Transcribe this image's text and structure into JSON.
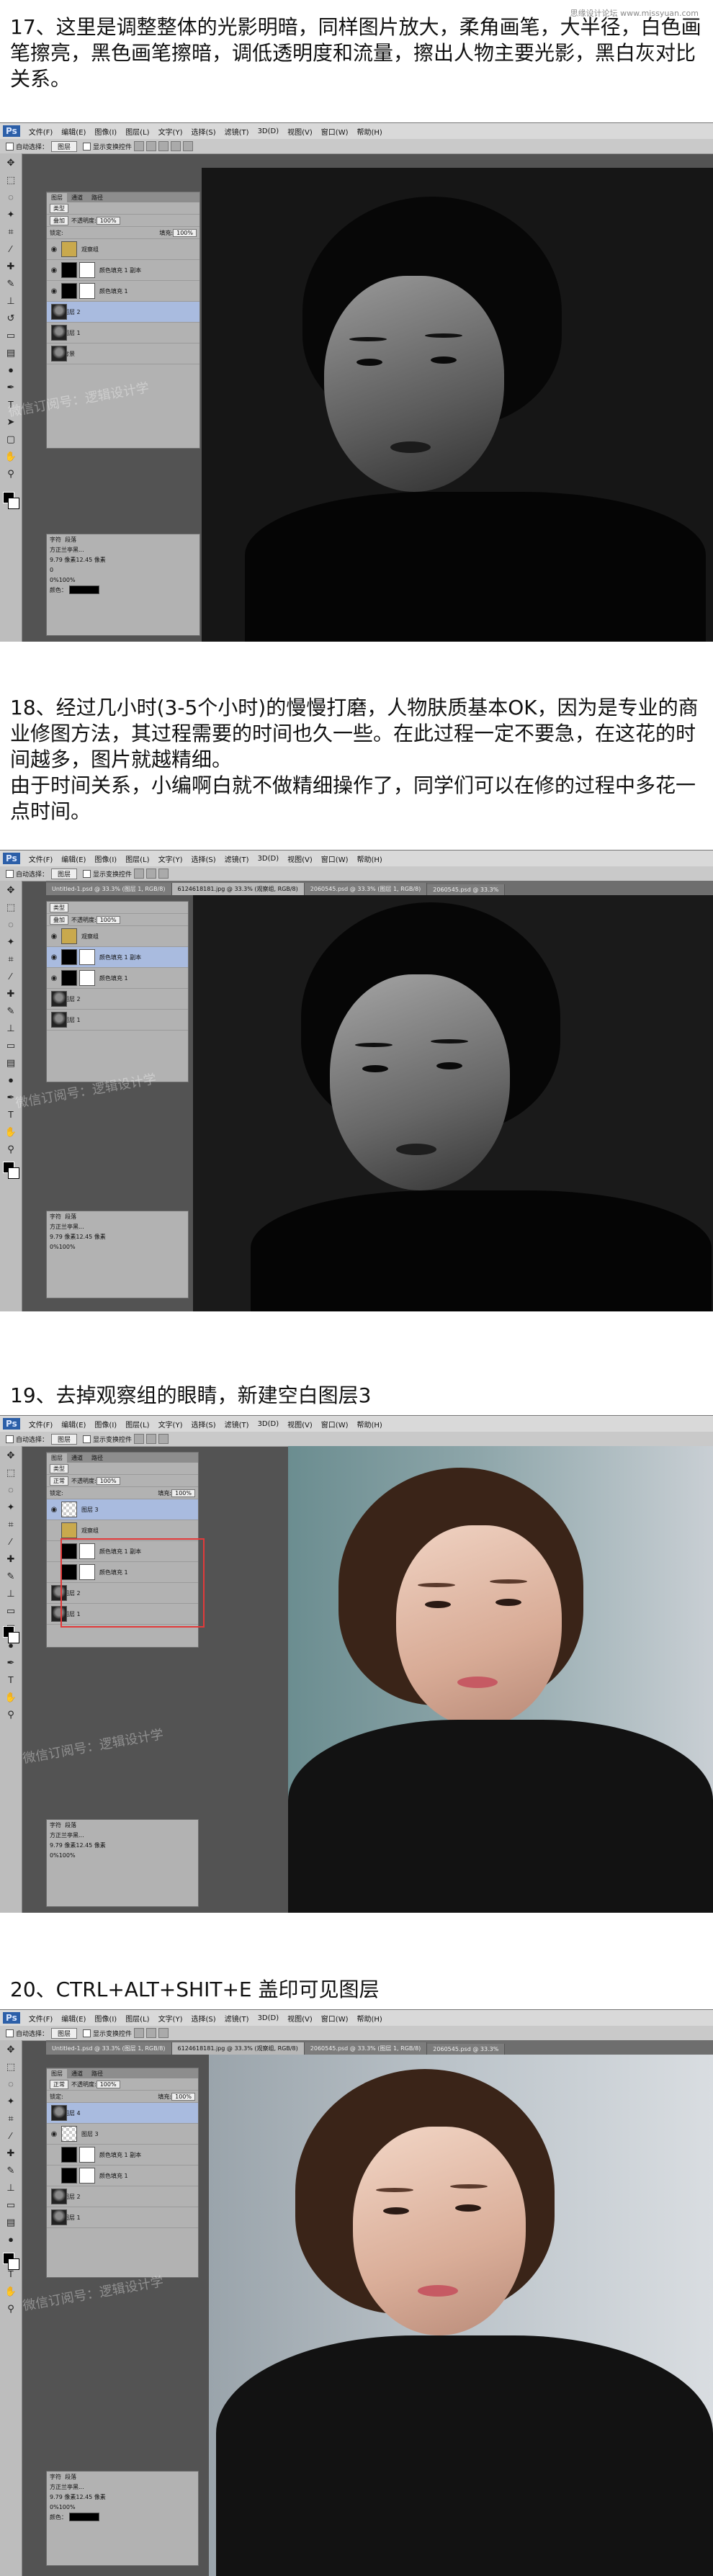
{
  "site_watermark": "思缘设计论坛 www.missyuan.com",
  "steps": [
    {
      "lines": [
        "17、这里是调整整体的光影明暗，同样图片放大，柔角画笔，大半径，白色画笔擦亮，黑色画笔擦暗，调低透明度和流量，擦出人物主要光影，黑白灰对比关系。"
      ]
    },
    {
      "lines": [
        "18、经过几小时(3-5个小时)的慢慢打磨，人物肤质基本OK，因为是专业的商业修图方法，其过程需要的时间也久一些。在此过程一定不要急，在这花的时间越多，图片就越精细。",
        "由于时间关系，小编啊白就不做精细操作了，同学们可以在修的过程中多花一点时间。"
      ]
    },
    {
      "lines": [
        "19、去掉观察组的眼睛，新建空白图层3"
      ]
    },
    {
      "lines": [
        "20、CTRL+ALT+SHIT+E 盖印可见图层"
      ]
    }
  ],
  "ps": {
    "logo": "Ps",
    "menu": [
      "文件(F)",
      "编辑(E)",
      "图像(I)",
      "图层(L)",
      "文字(Y)",
      "选择(S)",
      "滤镜(T)",
      "3D(D)",
      "视图(V)",
      "窗口(W)",
      "帮助(H)"
    ],
    "options": {
      "auto_select": "自动选择：",
      "group": "图层",
      "transform": "显示变换控件"
    },
    "tabs": [
      "Untitled-1.psd @ 33.3% (图层 1, RGB/8)",
      "6124618181.jpg @ 33.3% (观察组, RGB/8)",
      "2060545.psd @ 33.3% (图层 1, RGB/8)",
      "2060545.psd @ 33.3%"
    ],
    "watermark": "微信订阅号：逻辑设计学",
    "layers_panel": {
      "tabs": [
        "图层",
        "通道",
        "路径"
      ],
      "kind": "类型",
      "blend_normal": "正常",
      "blend_overlay": "叠加",
      "opacity_label": "不透明度:",
      "opacity_value": "100%",
      "lock_label": "锁定:",
      "fill_label": "填充:",
      "fill_value": "100%",
      "group_name": "观察组",
      "layer_names": {
        "hue_copy": "颜色填充 1 副本",
        "hue": "颜色填充 1",
        "layer1": "图层 1",
        "layer2": "图层 2",
        "layer3": "图层 3",
        "layer4": "图层 4",
        "bg": "背景"
      }
    },
    "char_panel": {
      "tabs": [
        "字符",
        "段落"
      ],
      "font": "方正兰亭黑...",
      "size": "9.79 像素",
      "leading": "12.45 像素",
      "tracking": "0",
      "scale_v": "0%",
      "scale_h": "100%",
      "color_label": "颜色："
    }
  }
}
